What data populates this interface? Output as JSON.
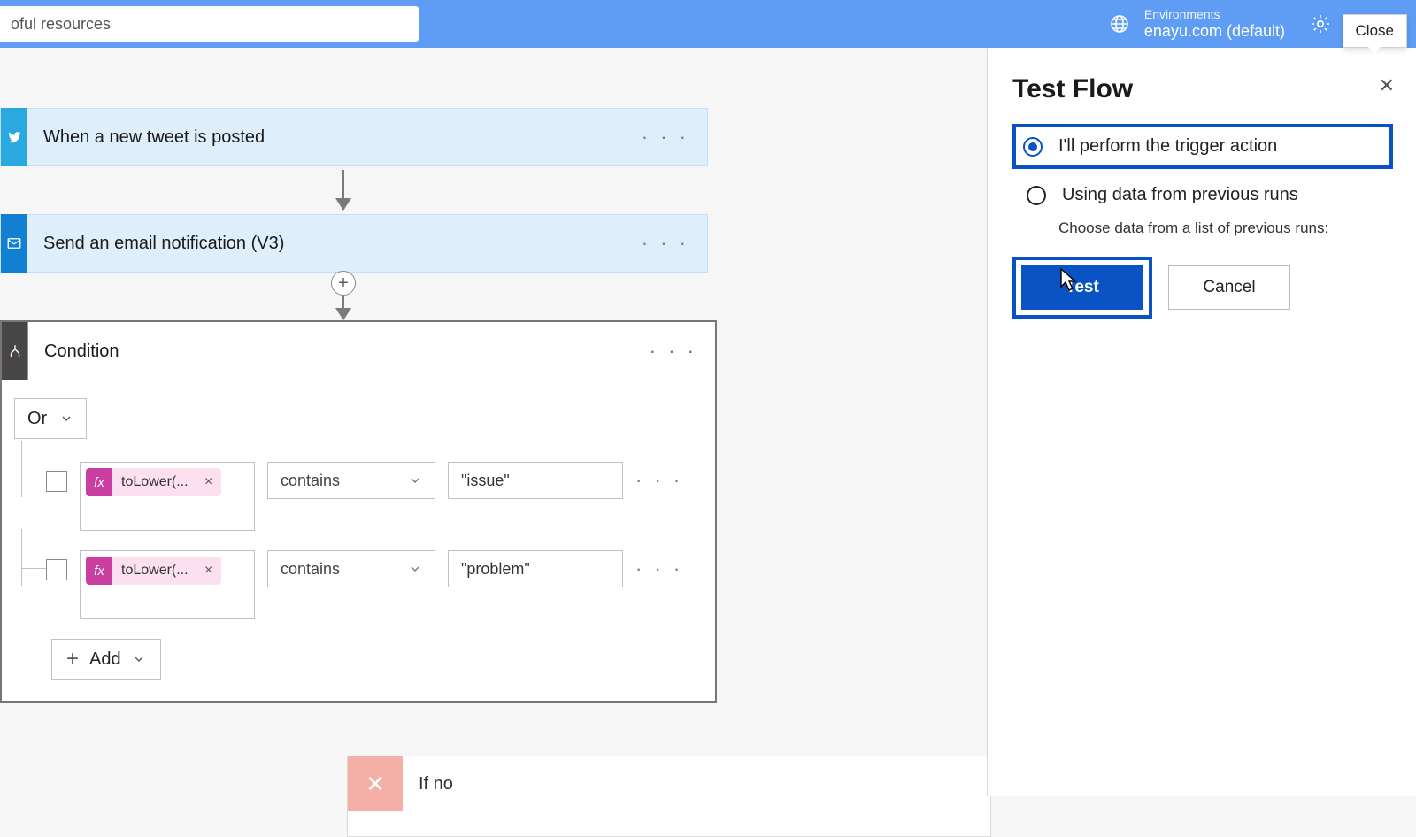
{
  "header": {
    "search_text": "oful resources",
    "env_label": "Environments",
    "env_value": "enayu.com (default)",
    "close_tooltip": "Close"
  },
  "flow": {
    "steps": [
      {
        "title": "When a new tweet is posted"
      },
      {
        "title": "Send an email notification (V3)"
      }
    ],
    "condition": {
      "title": "Condition",
      "group_operator": "Or",
      "rules": [
        {
          "token": "toLower(...",
          "operator": "contains",
          "value": "\"issue\""
        },
        {
          "token": "toLower(...",
          "operator": "contains",
          "value": "\"problem\""
        }
      ],
      "add_label": "Add"
    },
    "branch_no": "If no"
  },
  "panel": {
    "title": "Test Flow",
    "opt1": "I'll perform the trigger action",
    "opt2": "Using data from previous runs",
    "opt2_sub": "Choose data from a list of previous runs:",
    "test_btn": "Test",
    "cancel_btn": "Cancel"
  }
}
